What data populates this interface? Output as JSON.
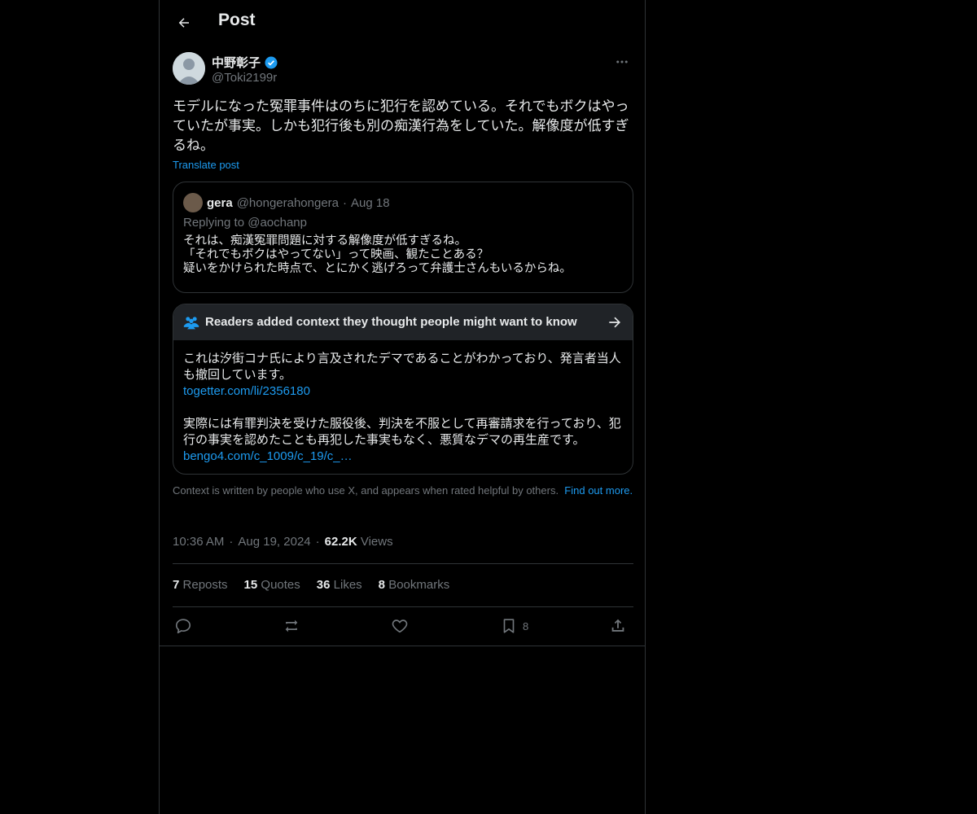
{
  "header": {
    "title": "Post"
  },
  "author": {
    "name": "中野彰子",
    "handle": "@Toki2199r"
  },
  "post": {
    "text": "モデルになった冤罪事件はのちに犯行を認めている。それでもボクはやっていたが事実。しかも犯行後も別の痴漢行為をしていた。解像度が低すぎるね。",
    "translate_label": "Translate post"
  },
  "quote": {
    "name": "gera",
    "handle": "@hongerahongera",
    "separator": "·",
    "date": "Aug 18",
    "replying": "Replying to @aochanp",
    "text": "それは、痴漢冤罪問題に対する解像度が低すぎるね。\n「それでもボクはやってない」って映画、観たことある？\n疑いをかけられた時点で、とにかく逃げろって弁護士さんもいるからね。"
  },
  "note": {
    "title": "Readers added context they thought people might want to know",
    "para1": "これは汐街コナ氏により言及されたデマであることがわかっており、発言者当人も撤回しています。",
    "link1": "togetter.com/li/2356180",
    "para2": "実際には有罪判決を受けた服役後、判決を不服として再審請求を行っており、犯行の事実を認めたことも再犯した事実もなく、悪質なデマの再生産です。",
    "link2": "bengo4.com/c_1009/c_19/c_…",
    "footer_text": "Context is written by people who use X, and appears when rated helpful by others.",
    "footer_link": "Find out more."
  },
  "meta": {
    "time": "10:36 AM",
    "sep": "·",
    "date": "Aug 19, 2024",
    "views_count": "62.2K",
    "views_label": "Views"
  },
  "stats": {
    "reposts_count": "7",
    "reposts_label": "Reposts",
    "quotes_count": "15",
    "quotes_label": "Quotes",
    "likes_count": "36",
    "likes_label": "Likes",
    "bookmarks_count": "8",
    "bookmarks_label": "Bookmarks"
  },
  "actions": {
    "bookmark_count": "8"
  },
  "icons": {
    "back": "arrow-left-icon",
    "verified": "verified-badge-icon",
    "more": "more-dots-icon",
    "notes": "community-notes-icon",
    "note_arrow": "arrow-right-icon",
    "reply": "reply-icon",
    "repost": "repost-icon",
    "like": "heart-icon",
    "bookmark": "bookmark-icon",
    "share": "share-icon"
  },
  "colors": {
    "background": "#000000",
    "text": "#e7e9ea",
    "muted": "#71767b",
    "accent": "#1d9bf0",
    "border": "#2f3336"
  }
}
